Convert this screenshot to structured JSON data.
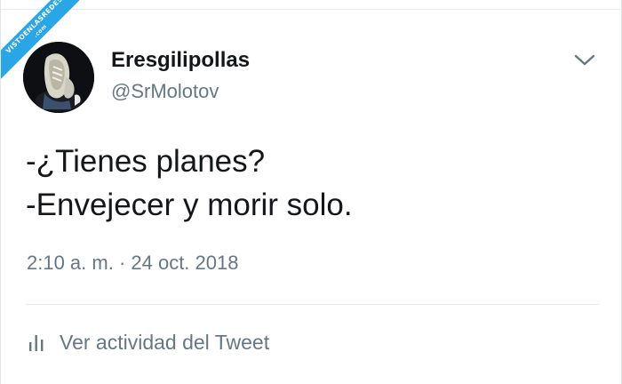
{
  "watermark": {
    "text": "VISTOENLASREDES",
    "sub": ".com"
  },
  "tweet": {
    "author_name": "Eresgilipollas",
    "author_handle": "@SrMolotov",
    "text_lines": [
      "-¿Tienes planes?",
      "-Envejecer y morir solo."
    ],
    "timestamp": "2:10 a. m. · 24 oct. 2018",
    "activity_label": "Ver actividad del Tweet"
  },
  "icons": {
    "menu": "chevron-down-icon",
    "activity": "bar-chart-icon"
  },
  "colors": {
    "primary_text": "#14171a",
    "secondary_text": "#657786",
    "divider": "#e6ecf0",
    "watermark_band": "#2aa6e6"
  }
}
